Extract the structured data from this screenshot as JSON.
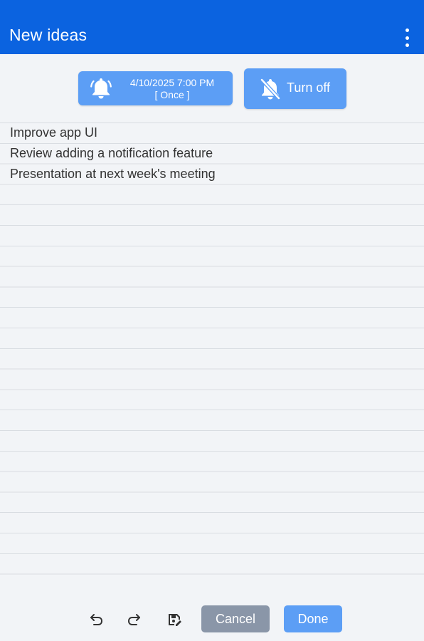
{
  "appbar": {
    "title": "New ideas",
    "menu_icon": "more-vert-icon"
  },
  "reminder": {
    "datetime": "4/10/2025 7:00 PM",
    "repeat": "[ Once ]",
    "icon": "bell-icon"
  },
  "turn_off": {
    "label": "Turn off",
    "icon": "bell-off-icon"
  },
  "note": {
    "lines": [
      "Improve app UI",
      "Review adding a notification feature",
      "Presentation at next week's meeting"
    ]
  },
  "toolbar": {
    "undo_icon": "undo-icon",
    "redo_icon": "redo-icon",
    "save_icon": "save-edit-icon",
    "cancel_label": "Cancel",
    "done_label": "Done"
  },
  "colors": {
    "appbar": "#0b63e0",
    "accent_button": "#5c9ef5",
    "cancel_button": "#8a96a8",
    "background": "#f2f4f7",
    "rule_line": "#d9dde2"
  }
}
